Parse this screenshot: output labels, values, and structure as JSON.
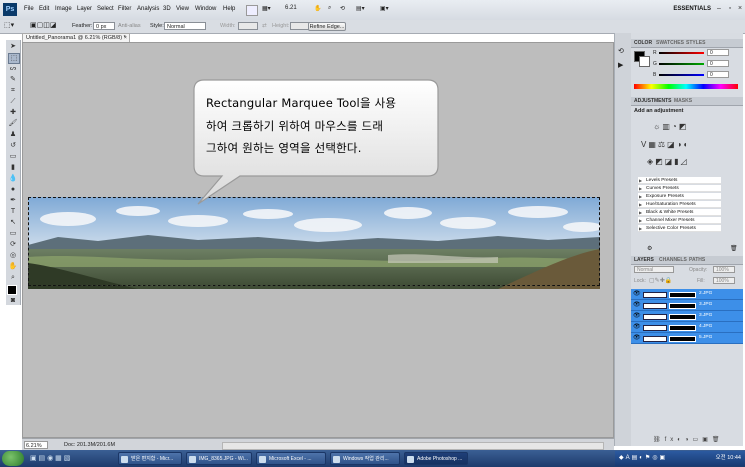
{
  "app": {
    "logo": "Ps",
    "menu": [
      "File",
      "Edit",
      "Image",
      "Layer",
      "Select",
      "Filter",
      "Analysis",
      "3D",
      "View",
      "Window",
      "Help"
    ],
    "zoom_dropdown": "6.21",
    "workspace": "ESSENTIALS",
    "window_controls": [
      "minimize-icon",
      "restore-icon",
      "close-icon"
    ]
  },
  "options_bar": {
    "feather_label": "Feather:",
    "feather_value": "0 px",
    "antialias_label": "Anti-alias",
    "style_label": "Style:",
    "style_value": "Normal",
    "width_label": "Width:",
    "height_label": "Height:",
    "refine_edge": "Refine Edge..."
  },
  "document": {
    "tab_title": "Untitled_Panorama1 @ 6.21% (RGB/8) *",
    "close_glyph": "×",
    "status_zoom": "6.21%",
    "status_info": "Doc: 201.3M/201.6M"
  },
  "callout": {
    "lines": [
      "Rectangular Marquee Tool을 사용",
      "하여 크롭하기 위하여 마우스를 드래",
      "그하여 원하는 영역을 선택한다."
    ]
  },
  "panels": {
    "color_tabs": [
      "COLOR",
      "SWATCHES",
      "STYLES"
    ],
    "color_channels": [
      {
        "label": "R",
        "value": "0",
        "color": "#d01010"
      },
      {
        "label": "G",
        "value": "0",
        "color": "#10a010"
      },
      {
        "label": "B",
        "value": "0",
        "color": "#1030d0"
      }
    ],
    "adjust_tabs": [
      "ADJUSTMENTS",
      "MASKS"
    ],
    "add_adjustment": "Add an adjustment",
    "presets": [
      "Levels Presets",
      "Curves Presets",
      "Exposure Presets",
      "Hue/Saturation Presets",
      "Black & White Presets",
      "Channel Mixer Presets",
      "Selective Color Presets"
    ],
    "layers_tabs": [
      "LAYERS",
      "CHANNELS",
      "PATHS"
    ],
    "blend_mode": "Normal",
    "opacity_label": "Opacity:",
    "opacity_value": "100%",
    "lock_label": "Lock:",
    "fill_label": "Fill:",
    "fill_value": "100%",
    "layers": [
      "2.JPG",
      "3.JPG",
      "3.JPG",
      "4.JPG",
      "5.JPG"
    ]
  },
  "taskbar": {
    "tasks": [
      "받은 편지함 - Micr...",
      "IMG_8365.JPG - Wi...",
      "Microsoft Excel - ...",
      "Windows 작업 관리...",
      "Adobe Photoshop ..."
    ],
    "clock": "오전 10:44"
  }
}
